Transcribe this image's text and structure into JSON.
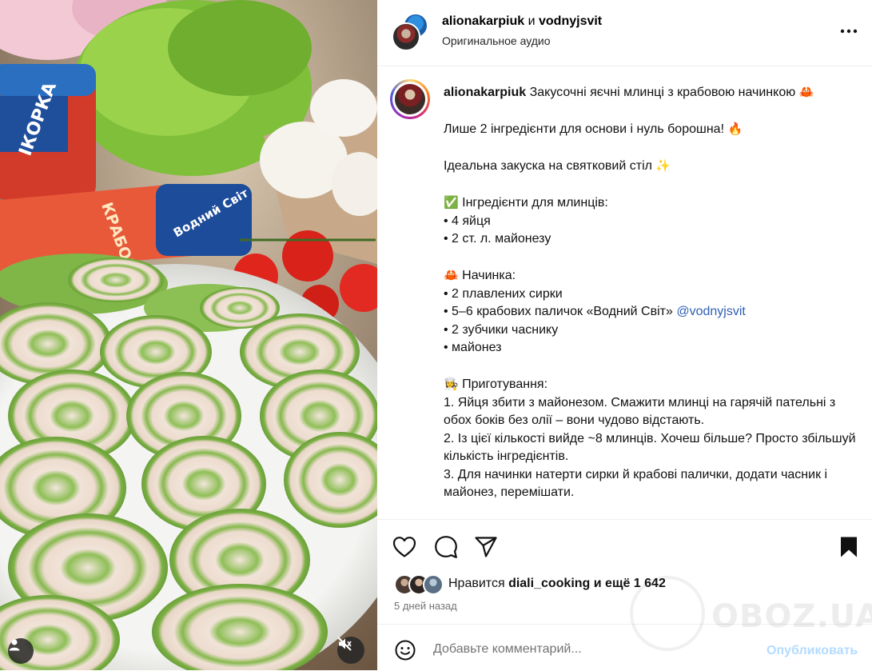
{
  "header": {
    "user1": "alionakarpiuk",
    "connector": "и",
    "user2": "vodnyjsvit",
    "subtitle": "Оригинальное аудио"
  },
  "media": {
    "package_text_1": "ІКОРКА",
    "package_text_2": "КРАБОВІ ПАЛ",
    "package_text_3": "Водний Світ"
  },
  "caption": {
    "username": "alionakarpiuk",
    "title": "Закусочні яєчні млинці з крабовою начинкою",
    "title_emoji": "🦀",
    "line_base": "Лише 2 інгредієнти для основи і нуль борошна!",
    "line_base_emoji": "🔥",
    "line_snack": "Ідеальна закуска на святковий стіл",
    "line_snack_emoji": "✨",
    "ingredients_emoji": "✅",
    "ingredients_title": "Інгредієнти для млинців:",
    "ingredients": [
      "• 4 яйця",
      "• 2 ст. л. майонезу"
    ],
    "filling_emoji": "🦀",
    "filling_title": "Начинка:",
    "filling_1": "• 2 плавлених сирки",
    "filling_2": "• 5–6 крабових паличок «Водний Світ»",
    "filling_2_mention": "@vodnyjsvit",
    "filling_3": "• 2 зубчики часнику",
    "filling_4": "• майонез",
    "prep_emoji": "👩‍🍳",
    "prep_title": "Приготування:",
    "steps": [
      "1. Яйця збити з майонезом. Смажити млинці на гарячій пательні з обох боків без олії – вони чудово відстають.",
      "2. Із цієї кількості вийде ~8 млинців. Хочеш більше? Просто збільшуй кількість інгредієнтів.",
      "3. Для начинки натерти сирки й крабові палички, додати часник і майонез, перемішати."
    ]
  },
  "actions": {
    "icons": [
      "heart-icon",
      "comment-icon",
      "share-icon",
      "bookmark-icon"
    ]
  },
  "likes": {
    "prefix": "Нравится",
    "user": "diali_cooking",
    "middle": "и ещё",
    "count": "1 642"
  },
  "time_ago": "5 дней назад",
  "comment": {
    "placeholder": "Добавьте комментарий...",
    "post_label": "Опубликовать"
  },
  "watermark": "OBOZ.UA",
  "colors": {
    "link": "#2f5fb3",
    "post_disabled": "#b3dbff",
    "muted": "#737373",
    "crepe_green": "#7fb34a"
  }
}
